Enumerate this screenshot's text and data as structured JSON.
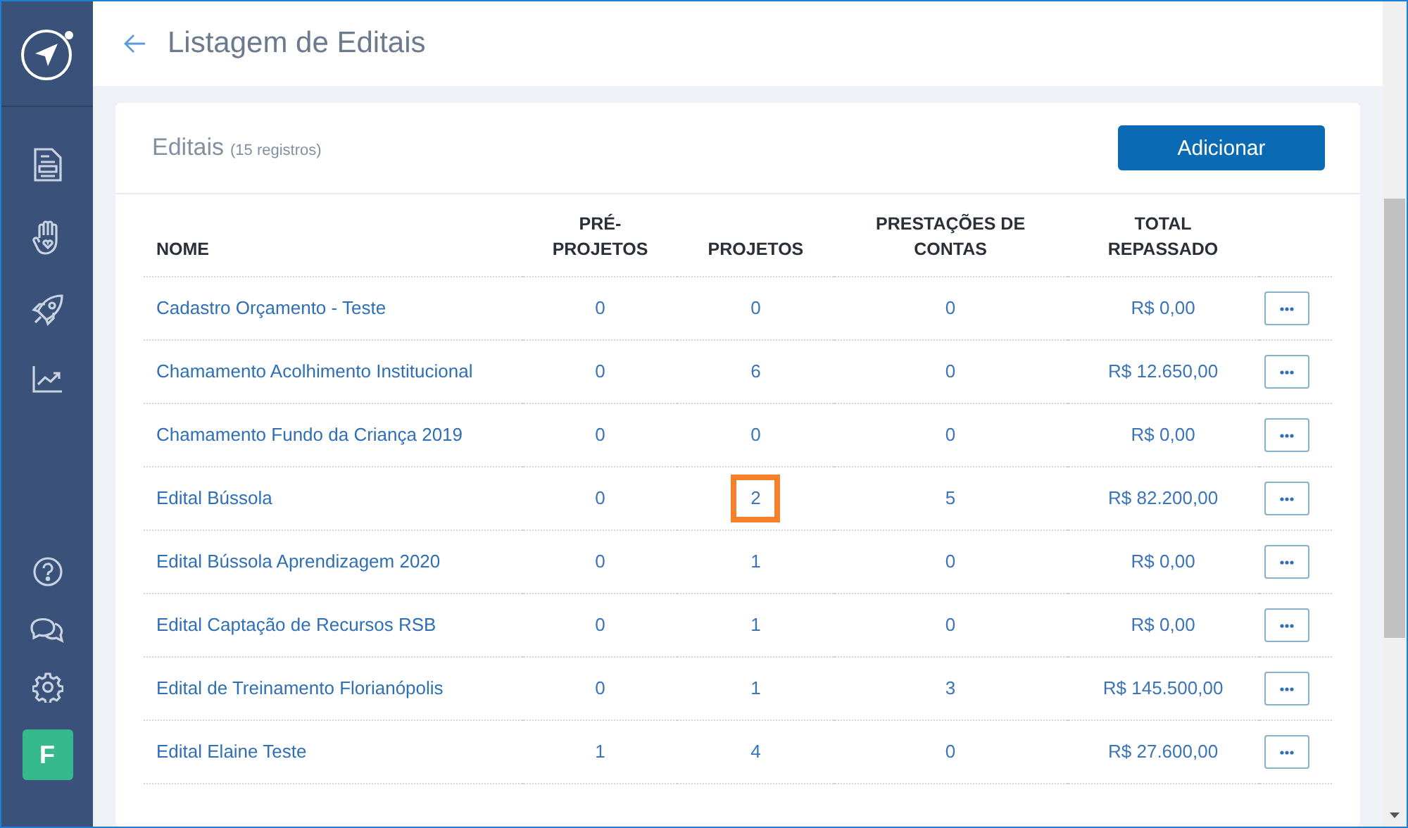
{
  "header": {
    "title": "Listagem de Editais"
  },
  "sidebar": {
    "avatar": "F"
  },
  "card": {
    "title": "Editais",
    "count": "(15 registros)",
    "add_button": "Adicionar"
  },
  "table": {
    "columns": [
      "NOME",
      "PRÉ-\nPROJETOS",
      "PROJETOS",
      "PRESTAÇÕES DE\nCONTAS",
      "TOTAL\nREPASSADO"
    ],
    "rows": [
      {
        "name": "Cadastro Orçamento - Teste",
        "pre_projetos": "0",
        "projetos": "0",
        "prestacoes": "0",
        "total": "R$ 0,00",
        "projetos_highlighted": false
      },
      {
        "name": "Chamamento Acolhimento Institucional",
        "pre_projetos": "0",
        "projetos": "6",
        "prestacoes": "0",
        "total": "R$ 12.650,00",
        "projetos_highlighted": false
      },
      {
        "name": "Chamamento Fundo da Criança 2019",
        "pre_projetos": "0",
        "projetos": "0",
        "prestacoes": "0",
        "total": "R$ 0,00",
        "projetos_highlighted": false
      },
      {
        "name": "Edital Bússola",
        "pre_projetos": "0",
        "projetos": "2",
        "prestacoes": "5",
        "total": "R$ 82.200,00",
        "projetos_highlighted": true
      },
      {
        "name": "Edital Bússola Aprendizagem 2020",
        "pre_projetos": "0",
        "projetos": "1",
        "prestacoes": "0",
        "total": "R$ 0,00",
        "projetos_highlighted": false
      },
      {
        "name": "Edital Captação de Recursos RSB",
        "pre_projetos": "0",
        "projetos": "1",
        "prestacoes": "0",
        "total": "R$ 0,00",
        "projetos_highlighted": false
      },
      {
        "name": "Edital de Treinamento Florianópolis",
        "pre_projetos": "0",
        "projetos": "1",
        "prestacoes": "3",
        "total": "R$ 145.500,00",
        "projetos_highlighted": false
      },
      {
        "name": "Edital Elaine Teste",
        "pre_projetos": "1",
        "projetos": "4",
        "prestacoes": "0",
        "total": "R$ 27.600,00",
        "projetos_highlighted": false
      }
    ]
  }
}
